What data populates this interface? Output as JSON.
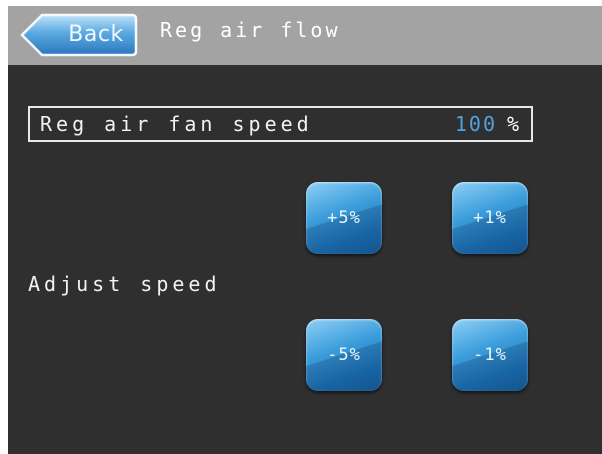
{
  "header": {
    "back_label": "Back",
    "title": "Reg air flow"
  },
  "fan_speed": {
    "label": "Reg air fan speed",
    "value": "100",
    "unit": "%"
  },
  "adjust": {
    "label": "Adjust speed",
    "buttons": {
      "plus5": "+5%",
      "plus1": "+1%",
      "minus5": "-5%",
      "minus1": "-1%"
    }
  },
  "colors": {
    "header_bg": "#a3a3a3",
    "screen_bg": "#2f2f2f",
    "value_accent": "#4fa3e0",
    "button_blue": "#2b86c9"
  }
}
